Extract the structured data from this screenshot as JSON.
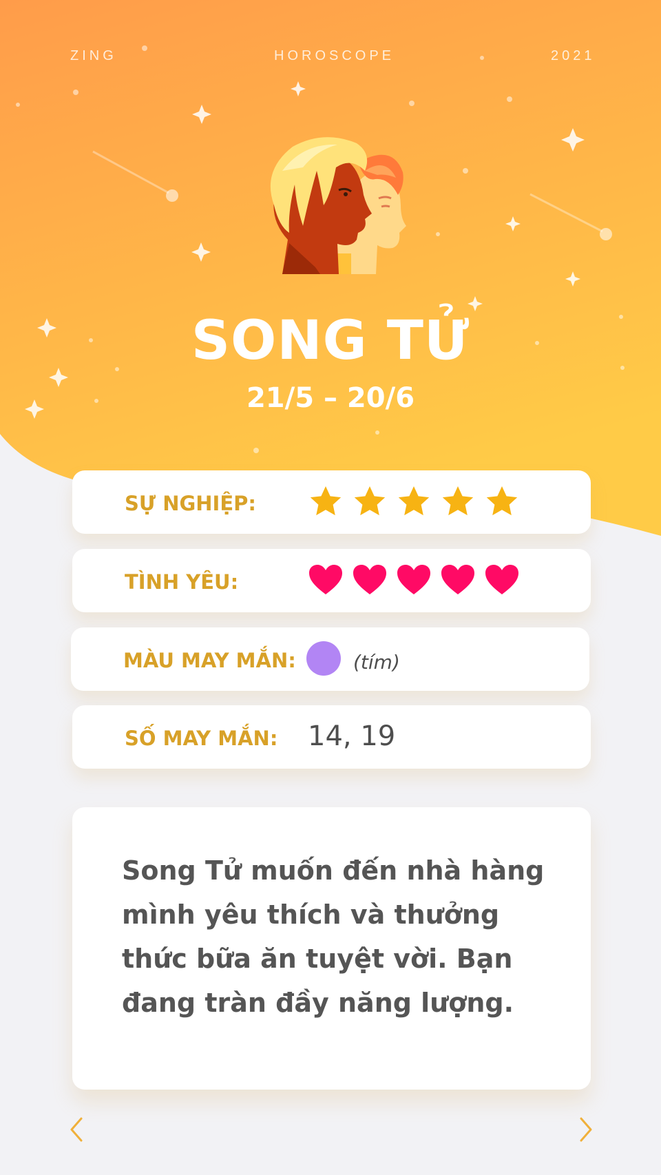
{
  "header": {
    "brand": "ZING",
    "section": "HOROSCOPE",
    "year": "2021"
  },
  "sign": {
    "name": "SONG TỬ",
    "dates": "21/5 – 20/6",
    "icon": "gemini-twins-icon"
  },
  "stats": {
    "career": {
      "label": "SỰ NGHIỆP:",
      "icon": "star-icon",
      "rating": 5,
      "max": 5,
      "color": "#f7b313"
    },
    "love": {
      "label": "TÌNH YÊU:",
      "icon": "heart-icon",
      "rating": 5,
      "max": 5,
      "color": "#ff0a65"
    },
    "lucky_color": {
      "label": "MÀU MAY MẮN:",
      "swatch": "#b285f4",
      "name": "(tím)"
    },
    "lucky_number": {
      "label": "SỐ MAY MẮN:",
      "value": "14, 19"
    }
  },
  "description": "Song Tử muốn đến nhà hàng mình yêu thích và thưởng thức bữa ăn tuyệt vời. Bạn đang tràn đầy năng lượng.",
  "nav": {
    "prev_icon": "chevron-left-icon",
    "next_icon": "chevron-right-icon"
  },
  "colors": {
    "accent": "#d8a128",
    "arrow": "#f0b03a",
    "hero_top": "#ff9c4a",
    "hero_bottom": "#ffc948"
  }
}
